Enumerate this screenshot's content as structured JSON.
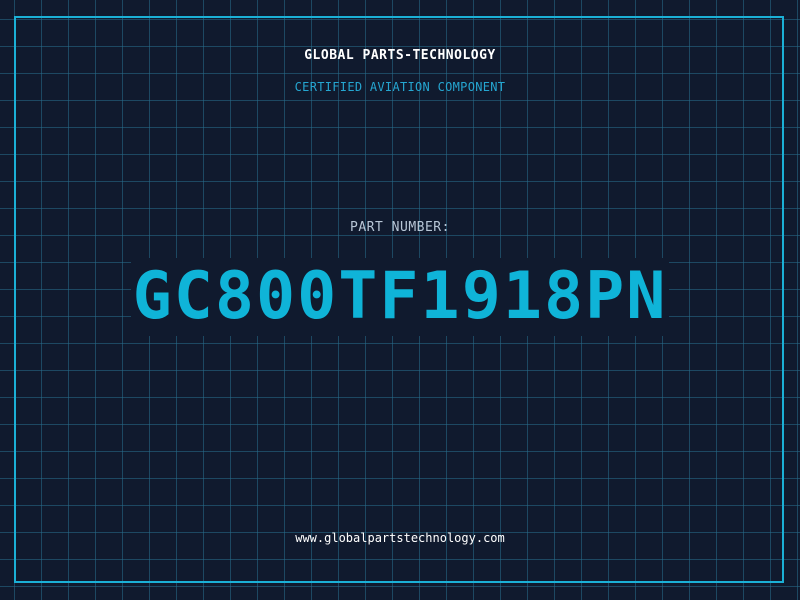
{
  "header": {
    "company": "GLOBAL PARTS-TECHNOLOGY",
    "subtitle": "CERTIFIED AVIATION COMPONENT"
  },
  "part": {
    "label": "PART NUMBER:",
    "number": "GC800TF1918PN"
  },
  "footer": {
    "website": "www.globalpartstechnology.com"
  },
  "colors": {
    "background": "#101a2e",
    "grid": "#286e8c",
    "accent": "#0fb4d8",
    "text": "#ffffff"
  }
}
